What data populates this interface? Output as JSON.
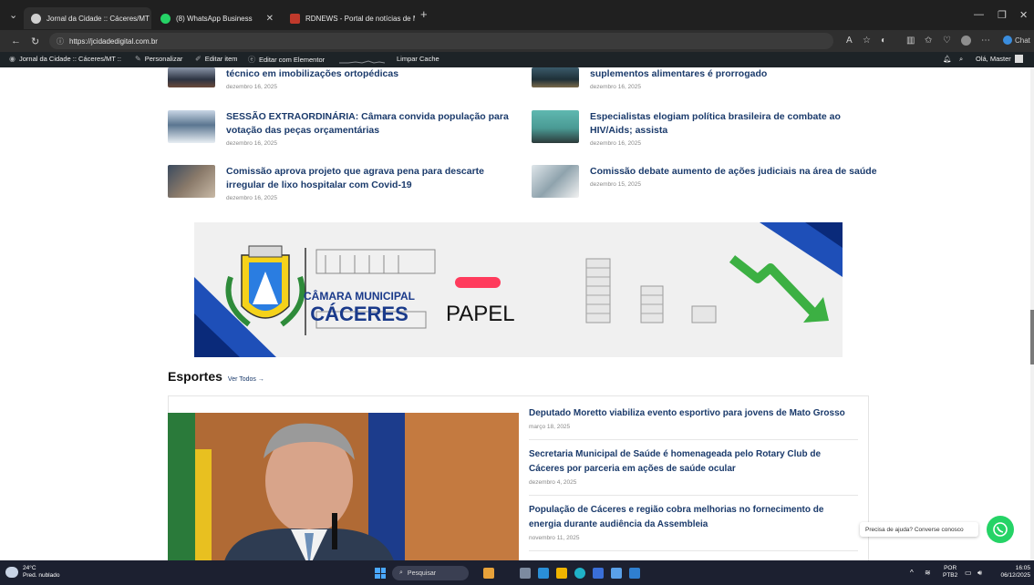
{
  "browser": {
    "tabs": [
      {
        "label": "Jornal da Cidade :: Cáceres/MT :: ..."
      },
      {
        "label": "(8) WhatsApp Business"
      },
      {
        "label": "RDNEWS - Portal de notícias de M..."
      }
    ],
    "url": "https://jcidadedigital.com.br",
    "chat_label": "Chat"
  },
  "admin_bar": {
    "site_name": "Jornal da Cidade :: Cáceres/MT ::",
    "customize": "Personalizar",
    "edit_item": "Editar item",
    "edit_elementor": "Editar com Elementor",
    "clear_cache": "Limpar Cache",
    "greeting": "Olá, Master"
  },
  "news": {
    "left": [
      {
        "title": "técnico em imobilizações ortopédicas",
        "title2": "",
        "date": "dezembro 16, 2025"
      },
      {
        "title": "SESSÃO EXTRAORDINÁRIA: Câmara convida população para",
        "title2": "votação das peças orçamentárias",
        "date": "dezembro 16, 2025"
      },
      {
        "title": "Comissão aprova projeto que agrava pena para descarte",
        "title2": "irregular de lixo hospitalar com Covid-19",
        "date": "dezembro 16, 2025"
      }
    ],
    "right": [
      {
        "title": "suplementos alimentares é prorrogado",
        "title2": "",
        "date": "dezembro 16, 2025"
      },
      {
        "title": "Especialistas elogiam política brasileira de combate ao",
        "title2": "HIV/Aids; assista",
        "date": "dezembro 16, 2025"
      },
      {
        "title": "Comissão debate aumento de ações judiciais na área de saúde",
        "title2": "",
        "date": "dezembro 15, 2025"
      }
    ]
  },
  "banner": {
    "line1": "CÂMARA MUNICIPAL",
    "line2": "CÁCERES",
    "word": "PAPEL"
  },
  "sports": {
    "title": "Esportes",
    "see_all": "Ver Todos →",
    "items": [
      {
        "title": "Deputado Moretto viabiliza evento esportivo para jovens de Mato Grosso",
        "title2": "",
        "date": "março 18, 2025"
      },
      {
        "title": "Secretaria Municipal de Saúde é homenageada pelo Rotary Club de",
        "title2": "Cáceres por parceria em ações de saúde ocular",
        "date": "dezembro 4, 2025"
      },
      {
        "title": "População de Cáceres e região cobra melhorias no fornecimento de",
        "title2": "energia durante audiência da Assembleia",
        "date": "novembro 11, 2025"
      }
    ]
  },
  "help": {
    "text": "Precisa de ajuda? Converse conosco"
  },
  "taskbar": {
    "temp": "24°C",
    "weather": "Pred. nublado",
    "search": "Pesquisar",
    "lang1": "POR",
    "lang2": "PTB2",
    "time": "16:05",
    "date": "06/12/2025"
  },
  "colors": {
    "accent": "#1a3a6b",
    "whatsapp": "#25d366",
    "admin_bg": "#1d2327"
  }
}
